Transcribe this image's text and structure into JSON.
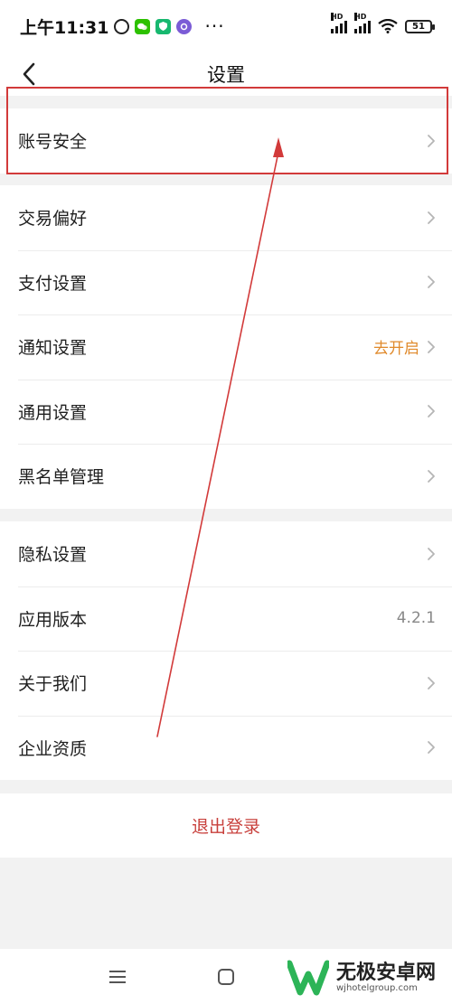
{
  "status_bar": {
    "time": "上午11:31",
    "icons": [
      "alarm-icon",
      "wechat-icon",
      "app-icon",
      "app-icon"
    ],
    "more": "···",
    "signal_label_1": "HD",
    "signal_label_2": "HD",
    "battery": "51"
  },
  "header": {
    "title": "设置",
    "back_icon": "chevron-left-icon"
  },
  "groups": [
    {
      "items": [
        {
          "label": "账号安全",
          "value": "",
          "chevron": true
        }
      ]
    },
    {
      "items": [
        {
          "label": "交易偏好",
          "value": "",
          "chevron": true
        },
        {
          "label": "支付设置",
          "value": "",
          "chevron": true
        },
        {
          "label": "通知设置",
          "value": "去开启",
          "chevron": true
        },
        {
          "label": "通用设置",
          "value": "",
          "chevron": true
        },
        {
          "label": "黑名单管理",
          "value": "",
          "chevron": true
        }
      ]
    },
    {
      "items": [
        {
          "label": "隐私设置",
          "value": "",
          "chevron": true
        },
        {
          "label": "应用版本",
          "value": "4.2.1",
          "chevron": false
        },
        {
          "label": "关于我们",
          "value": "",
          "chevron": true
        },
        {
          "label": "企业资质",
          "value": "",
          "chevron": true
        }
      ]
    }
  ],
  "logout": {
    "label": "退出登录"
  },
  "colors": {
    "accent_orange": "#e08a2c",
    "logout_red": "#c8403c",
    "annotation_red": "#d23a3a",
    "background": "#f2f2f2"
  },
  "watermark": {
    "title": "无极安卓网",
    "url": "wjhotelgroup.com"
  }
}
